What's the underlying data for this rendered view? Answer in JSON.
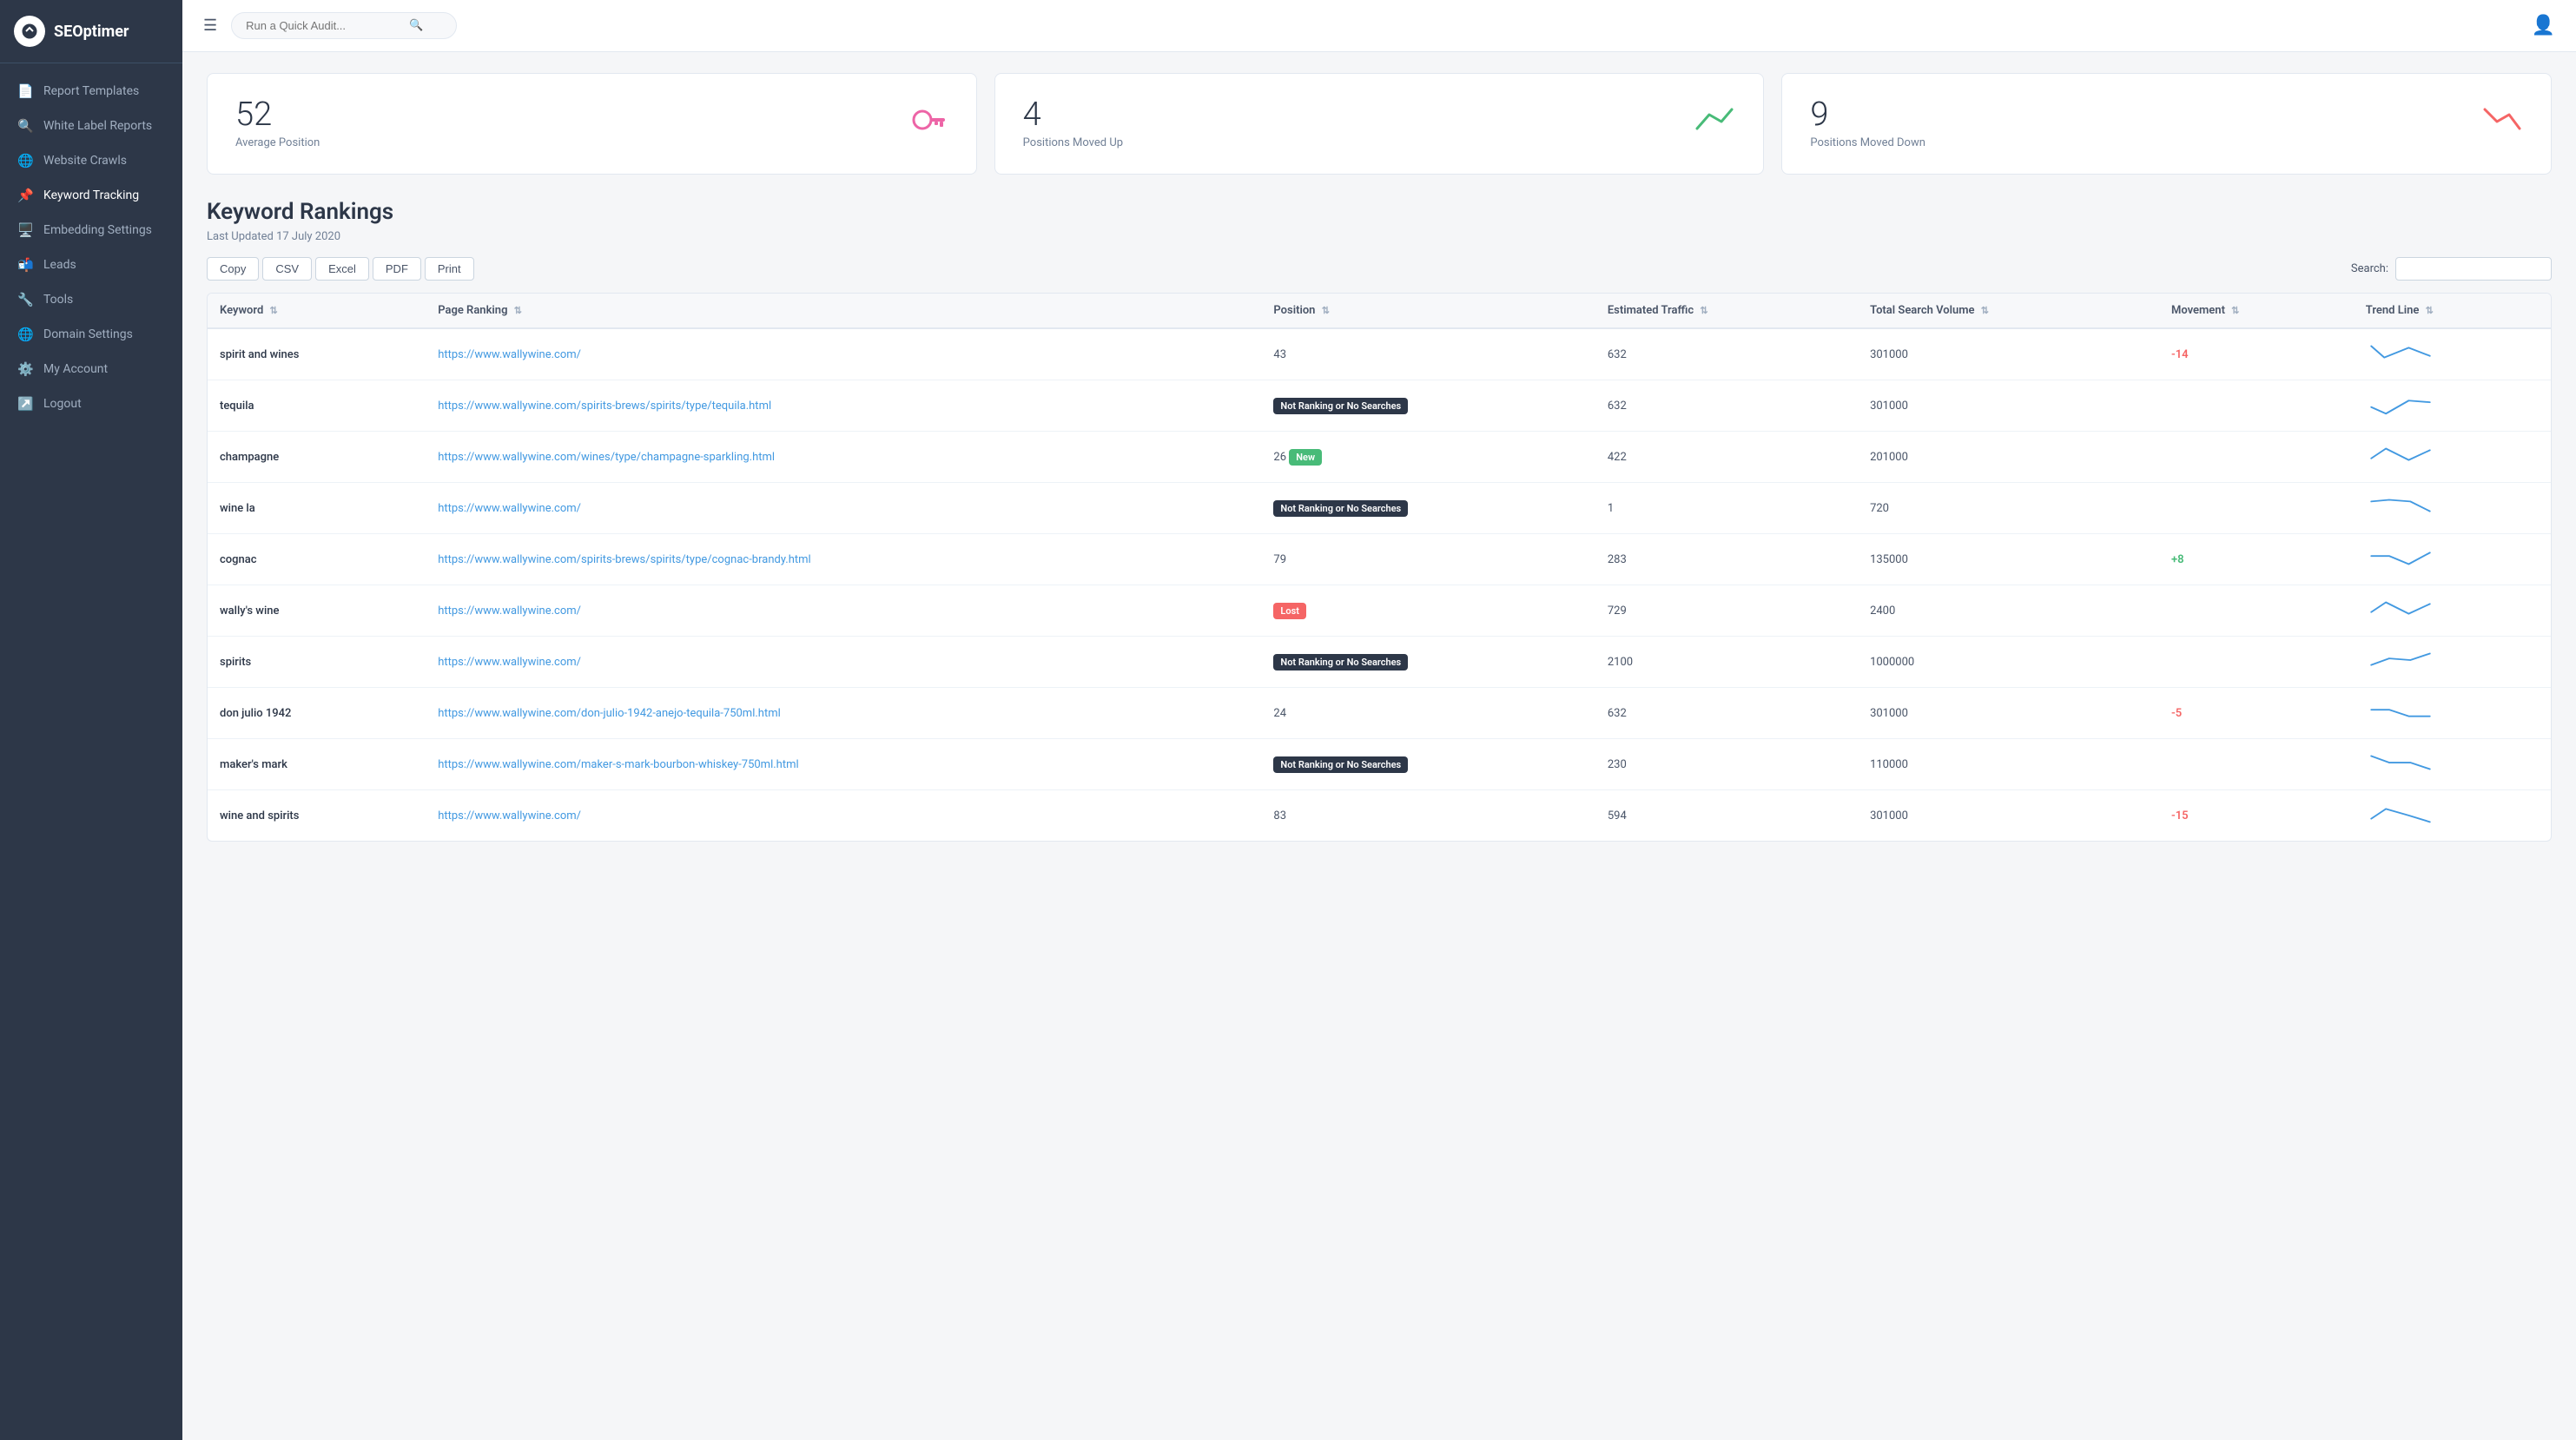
{
  "sidebar": {
    "logo_text": "SEOptimer",
    "items": [
      {
        "id": "report-templates",
        "label": "Report Templates",
        "icon": "📄"
      },
      {
        "id": "white-label-reports",
        "label": "White Label Reports",
        "icon": "🔍"
      },
      {
        "id": "website-crawls",
        "label": "Website Crawls",
        "icon": "🌐"
      },
      {
        "id": "keyword-tracking",
        "label": "Keyword Tracking",
        "icon": "📌",
        "active": true
      },
      {
        "id": "embedding-settings",
        "label": "Embedding Settings",
        "icon": "🖥️"
      },
      {
        "id": "leads",
        "label": "Leads",
        "icon": "📬"
      },
      {
        "id": "tools",
        "label": "Tools",
        "icon": "🔧"
      },
      {
        "id": "domain-settings",
        "label": "Domain Settings",
        "icon": "🌐"
      },
      {
        "id": "my-account",
        "label": "My Account",
        "icon": "⚙️"
      },
      {
        "id": "logout",
        "label": "Logout",
        "icon": "↗️"
      }
    ]
  },
  "topbar": {
    "search_placeholder": "Run a Quick Audit..."
  },
  "stats": [
    {
      "id": "avg-position",
      "number": "52",
      "label": "Average Position",
      "icon_type": "key",
      "icon": "🔑"
    },
    {
      "id": "positions-up",
      "number": "4",
      "label": "Positions Moved Up",
      "icon_type": "up",
      "icon": "↗"
    },
    {
      "id": "positions-down",
      "number": "9",
      "label": "Positions Moved Down",
      "icon_type": "down",
      "icon": "↘"
    }
  ],
  "section": {
    "title": "Keyword Rankings",
    "subtitle": "Last Updated 17 July 2020"
  },
  "export_buttons": [
    "Copy",
    "CSV",
    "Excel",
    "PDF",
    "Print"
  ],
  "search_label": "Search:",
  "table": {
    "columns": [
      {
        "id": "keyword",
        "label": "Keyword"
      },
      {
        "id": "page-ranking",
        "label": "Page Ranking"
      },
      {
        "id": "position",
        "label": "Position"
      },
      {
        "id": "estimated-traffic",
        "label": "Estimated Traffic"
      },
      {
        "id": "total-search-volume",
        "label": "Total Search Volume"
      },
      {
        "id": "movement",
        "label": "Movement"
      },
      {
        "id": "trend-line",
        "label": "Trend Line"
      }
    ],
    "rows": [
      {
        "keyword": "spirit and wines",
        "url": "https://www.wallywine.com/",
        "position": "43",
        "position_badge": null,
        "estimated_traffic": "632",
        "total_search_volume": "301000",
        "movement": "-14",
        "movement_type": "neg",
        "trend": "down-up-down"
      },
      {
        "keyword": "tequila",
        "url": "https://www.wallywine.com/spirits-brews/spirits/type/tequila.html",
        "position": null,
        "position_badge": "Not Ranking or No Searches",
        "position_badge_type": "dark",
        "estimated_traffic": "632",
        "total_search_volume": "301000",
        "movement": "",
        "movement_type": "none",
        "trend": "down-up-flat"
      },
      {
        "keyword": "champagne",
        "url": "https://www.wallywine.com/wines/type/champagne-sparkling.html",
        "position": "26",
        "position_badge": "New",
        "position_badge_type": "green",
        "estimated_traffic": "422",
        "total_search_volume": "201000",
        "movement": "",
        "movement_type": "none",
        "trend": "up-down-up"
      },
      {
        "keyword": "wine la",
        "url": "https://www.wallywine.com/",
        "position": null,
        "position_badge": "Not Ranking or No Searches",
        "position_badge_type": "dark",
        "estimated_traffic": "1",
        "total_search_volume": "720",
        "movement": "",
        "movement_type": "none",
        "trend": "up-flat-down"
      },
      {
        "keyword": "cognac",
        "url": "https://www.wallywine.com/spirits-brews/spirits/type/cognac-brandy.html",
        "position": "79",
        "position_badge": null,
        "estimated_traffic": "283",
        "total_search_volume": "135000",
        "movement": "+8",
        "movement_type": "pos",
        "trend": "flat-down-up"
      },
      {
        "keyword": "wally's wine",
        "url": "https://www.wallywine.com/",
        "position": null,
        "position_badge": "Lost",
        "position_badge_type": "red",
        "estimated_traffic": "729",
        "total_search_volume": "2400",
        "movement": "",
        "movement_type": "none",
        "trend": "up-down-up"
      },
      {
        "keyword": "spirits",
        "url": "https://www.wallywine.com/",
        "position": null,
        "position_badge": "Not Ranking or No Searches",
        "position_badge_type": "dark",
        "estimated_traffic": "2100",
        "total_search_volume": "1000000",
        "movement": "",
        "movement_type": "none",
        "trend": "up-flat-up"
      },
      {
        "keyword": "don julio 1942",
        "url": "https://www.wallywine.com/don-julio-1942-anejo-tequila-750ml.html",
        "position": "24",
        "position_badge": null,
        "estimated_traffic": "632",
        "total_search_volume": "301000",
        "movement": "-5",
        "movement_type": "neg",
        "trend": "flat-down-flat"
      },
      {
        "keyword": "maker's mark",
        "url": "https://www.wallywine.com/maker-s-mark-bourbon-whiskey-750ml.html",
        "position": null,
        "position_badge": "Not Ranking or No Searches",
        "position_badge_type": "dark",
        "estimated_traffic": "230",
        "total_search_volume": "110000",
        "movement": "",
        "movement_type": "none",
        "trend": "down-flat-down"
      },
      {
        "keyword": "wine and spirits",
        "url": "https://www.wallywine.com/",
        "position": "83",
        "position_badge": null,
        "estimated_traffic": "594",
        "total_search_volume": "301000",
        "movement": "-15",
        "movement_type": "neg",
        "trend": "up-down-down"
      }
    ]
  }
}
